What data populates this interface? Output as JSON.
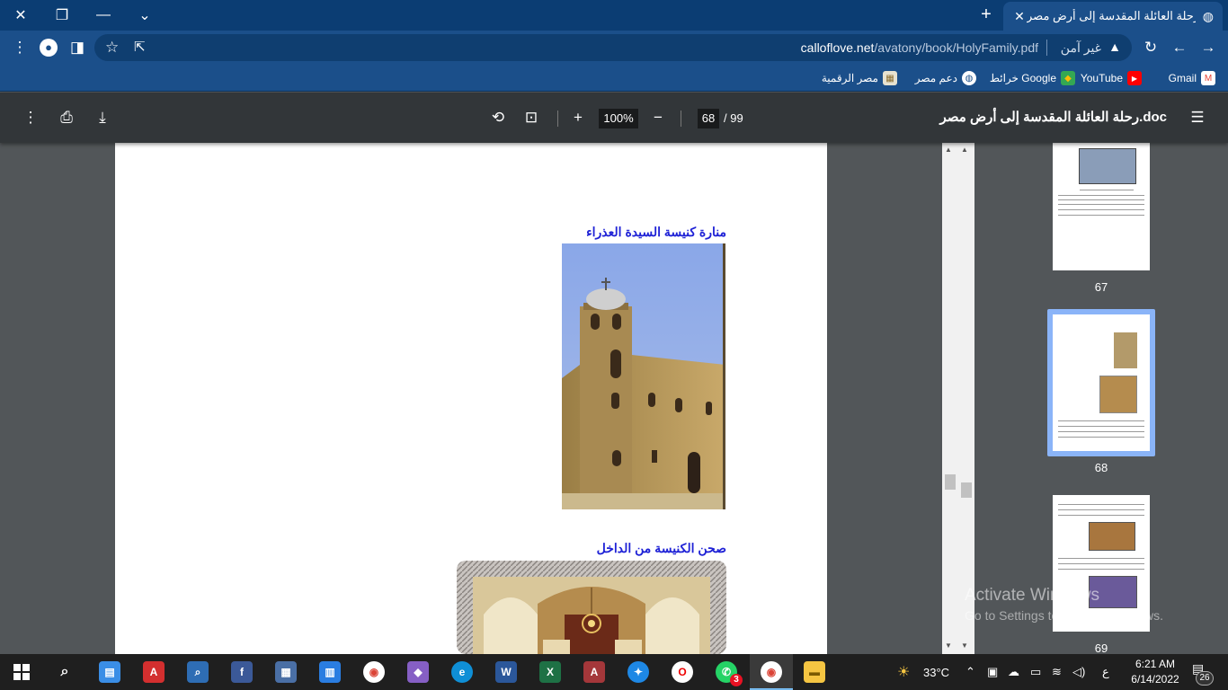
{
  "browser": {
    "tab_title": "رحلة العائلة المقدسة إلى أرض مصر",
    "tab_close": "✕",
    "new_tab": "+",
    "window_controls": {
      "close": "✕",
      "restore": "❐",
      "minimize": "—",
      "tabs_menu": "⌄"
    },
    "url_domain": "calloflove.net",
    "url_path": "/avatony/book/HolyFamily.pdf",
    "security_label": "غير آمن",
    "bookmarks": [
      {
        "label": "Gmail",
        "icon": "gmail-icon",
        "color": "#ea4335",
        "glyph": "M"
      },
      {
        "label": "YouTube",
        "icon": "youtube-icon",
        "color": "#ff0000",
        "glyph": "▶"
      },
      {
        "label": "خرائط Google",
        "icon": "google-maps-icon",
        "color": "#34a853",
        "glyph": "◆"
      },
      {
        "label": "دعم مصر",
        "icon": "globe-icon",
        "color": "#1b4f8a",
        "glyph": "◍"
      },
      {
        "label": "مصر الرقمية",
        "icon": "digital-egypt-icon",
        "color": "#e7e2d0",
        "glyph": "▦"
      }
    ]
  },
  "pdf": {
    "title": "رحلة العائلة المقدسة إلى أرض مصر.doc",
    "current_page": "68",
    "total_pages": "/ 99",
    "zoom": "100%",
    "captions": {
      "tower": "منارة كنيسة السيدة العذراء",
      "courtyard": "صحن الكنيسة من الداخل"
    },
    "thumbnails": [
      {
        "number": "67"
      },
      {
        "number": "68"
      },
      {
        "number": "69"
      }
    ]
  },
  "watermark": {
    "line1": "Activate Windows",
    "line2": "Go to Settings to activate Windows."
  },
  "taskbar": {
    "temperature": "33°C",
    "time": "6:21 AM",
    "date": "6/14/2022",
    "notifications": "26",
    "whatsapp_badge": "3",
    "lang": "ع"
  },
  "colors": {
    "caption": "#1f22d6",
    "titlebar": "#0b3d73",
    "toolbar": "#1b4f8a",
    "pdf_toolbar": "#323639"
  }
}
